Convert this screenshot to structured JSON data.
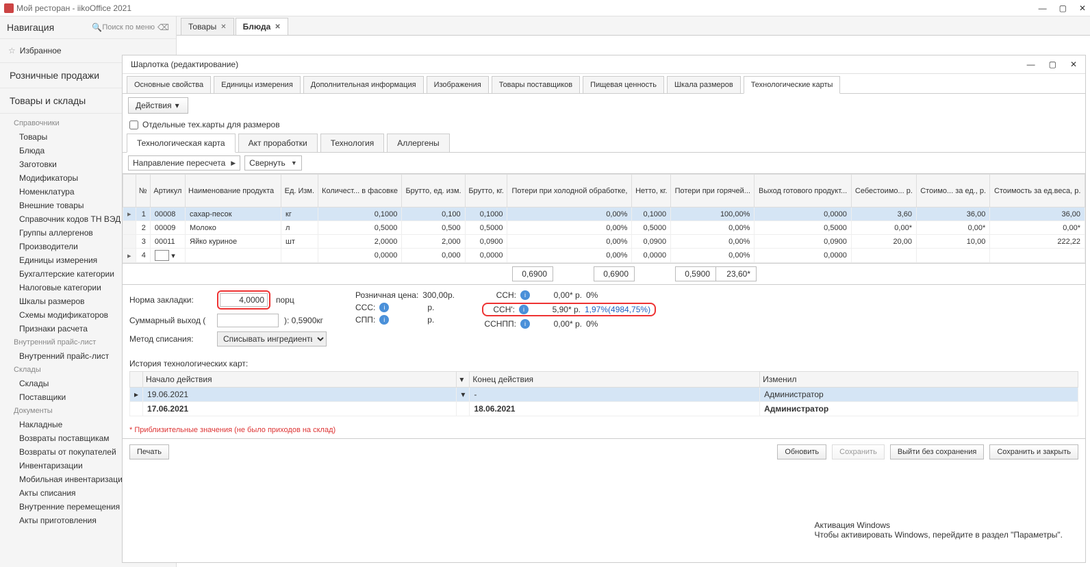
{
  "app": {
    "title": "Мой ресторан - iikoOffice 2021"
  },
  "nav": {
    "title": "Навигация",
    "search_placeholder": "Поиск по меню",
    "favorites": "Избранное",
    "sections": {
      "retail": "Розничные продажи",
      "goods": "Товары и склады"
    },
    "groups": {
      "refs": "Справочники",
      "pricelist": "Внутренний прайс-лист",
      "warehouses": "Склады",
      "documents": "Документы"
    },
    "items": {
      "tovary": "Товары",
      "bluda": "Блюда",
      "zagotovki": "Заготовки",
      "modif": "Модификаторы",
      "nomen": "Номенклатура",
      "ext": "Внешние товары",
      "tnved": "Справочник кодов ТН ВЭД",
      "allerg": "Группы аллергенов",
      "prod": "Производители",
      "units": "Единицы измерения",
      "buh": "Бухгалтерские категории",
      "tax": "Налоговые категории",
      "scales": "Шкалы размеров",
      "modsch": "Схемы модификаторов",
      "calc": "Признаки расчета",
      "intprice": "Внутренний прайс-лист",
      "sklady": "Склады",
      "suppl": "Поставщики",
      "nakl": "Накладные",
      "retsup": "Возвраты поставщикам",
      "retbuy": "Возвраты от покупателей",
      "inv": "Инвентаризации",
      "mobinv": "Мобильная инвентаризация",
      "writeoff": "Акты списания",
      "intmove": "Внутренние перемещения",
      "cook": "Акты приготовления"
    }
  },
  "tabs": {
    "t1": "Товары",
    "t2": "Блюда"
  },
  "editor": {
    "title": "Шарлотка  (редактирование)",
    "prop_tabs": {
      "p1": "Основные свойства",
      "p2": "Единицы измерения",
      "p3": "Дополнительная информация",
      "p4": "Изображения",
      "p5": "Товары поставщиков",
      "p6": "Пищевая ценность",
      "p7": "Шкала размеров",
      "p8": "Технологические карты"
    },
    "actions_btn": "Действия",
    "checkbox": "Отдельные тех.карты для размеров",
    "sub_tabs": {
      "s1": "Технологическая карта",
      "s2": "Акт проработки",
      "s3": "Технология",
      "s4": "Аллергены"
    },
    "recalc": "Направление пересчета",
    "collapse": "Свернуть"
  },
  "grid": {
    "headers": {
      "num": "№",
      "art": "Артикул",
      "name": "Наименование продукта",
      "unit": "Ед. Изм.",
      "qty": "Количест... в фасовке",
      "gross": "Брутто, ед. изм.",
      "gross_kg": "Брутто, кг.",
      "cold": "Потери при холодной обработке,",
      "net": "Нетто, кг.",
      "hot": "Потери при горячей...",
      "out": "Выход готового продукт...",
      "cost": "Себестоимо... р.",
      "unit_cost": "Стоимо... за ед., р.",
      "weight_cost": "Стоимость за ед.веса, p."
    },
    "rows": [
      {
        "n": "1",
        "art": "00008",
        "name": "сахар-песок",
        "unit": "кг",
        "qty": "0,1000",
        "gross": "0,100",
        "gkg": "0,1000",
        "cold": "0,00%",
        "net": "0,1000",
        "hot": "100,00%",
        "out": "0,0000",
        "cost": "3,60",
        "ucost": "36,00",
        "wcost": "36,00"
      },
      {
        "n": "2",
        "art": "00009",
        "name": "Молоко",
        "unit": "л",
        "qty": "0,5000",
        "gross": "0,500",
        "gkg": "0,5000",
        "cold": "0,00%",
        "net": "0,5000",
        "hot": "0,00%",
        "out": "0,5000",
        "cost": "0,00*",
        "ucost": "0,00*",
        "wcost": "0,00*"
      },
      {
        "n": "3",
        "art": "00011",
        "name": "Яйко куриное",
        "unit": "шт",
        "qty": "2,0000",
        "gross": "2,000",
        "gkg": "0,0900",
        "cold": "0,00%",
        "net": "0,0900",
        "hot": "0,00%",
        "out": "0,0900",
        "cost": "20,00",
        "ucost": "10,00",
        "wcost": "222,22"
      },
      {
        "n": "4",
        "art": "",
        "name": "",
        "unit": "",
        "qty": "0,0000",
        "gross": "0,000",
        "gkg": "0,0000",
        "cold": "0,00%",
        "net": "0,0000",
        "hot": "0,00%",
        "out": "0,0000",
        "cost": "",
        "ucost": "",
        "wcost": ""
      }
    ],
    "totals": {
      "gkg": "0,6900",
      "net": "0,6900",
      "out": "0,5900",
      "cost": "23,60*"
    }
  },
  "form": {
    "norma_label": "Норма закладки:",
    "norma_value": "4,0000",
    "norma_unit": "порц",
    "sum_label": "Суммарный выход (",
    "sum_suffix": "): 0,5900кг",
    "method_label": "Метод списания:",
    "method_value": "Списывать ингредиенты",
    "retail_label": "Розничная цена:",
    "retail_value": "300,00р.",
    "ccc": "ССС:",
    "ccc_val": "р.",
    "spp": "СПП:",
    "spp_val": "р.",
    "ssn": "ССН:",
    "ssn_val": "0,00* р.",
    "ssn_pct": "0%",
    "ssn2": "ССН':",
    "ssn2_val": "5,90* р.",
    "ssn2_pct": "1,97%(4984,75%)",
    "ssnpp": "ССНПП:",
    "ssnpp_val": "0,00* р.",
    "ssnpp_pct": "0%"
  },
  "history": {
    "title": "История технологических карт:",
    "h1": "Начало действия",
    "h2": "Конец действия",
    "h3": "Изменил",
    "r1_start": "19.06.2021",
    "r1_end": "-",
    "r1_by": "Администратор",
    "r2_start": "17.06.2021",
    "r2_end": "18.06.2021",
    "r2_by": "Администратор"
  },
  "note": "* Приблизительные значения (не было приходов на склад)",
  "buttons": {
    "print": "Печать",
    "refresh": "Обновить",
    "save": "Сохранить",
    "exit": "Выйти без сохранения",
    "save_close": "Сохранить и закрыть"
  },
  "watermark": {
    "title": "Активация Windows",
    "sub": "Чтобы активировать Windows, перейдите в раздел \"Параметры\"."
  }
}
